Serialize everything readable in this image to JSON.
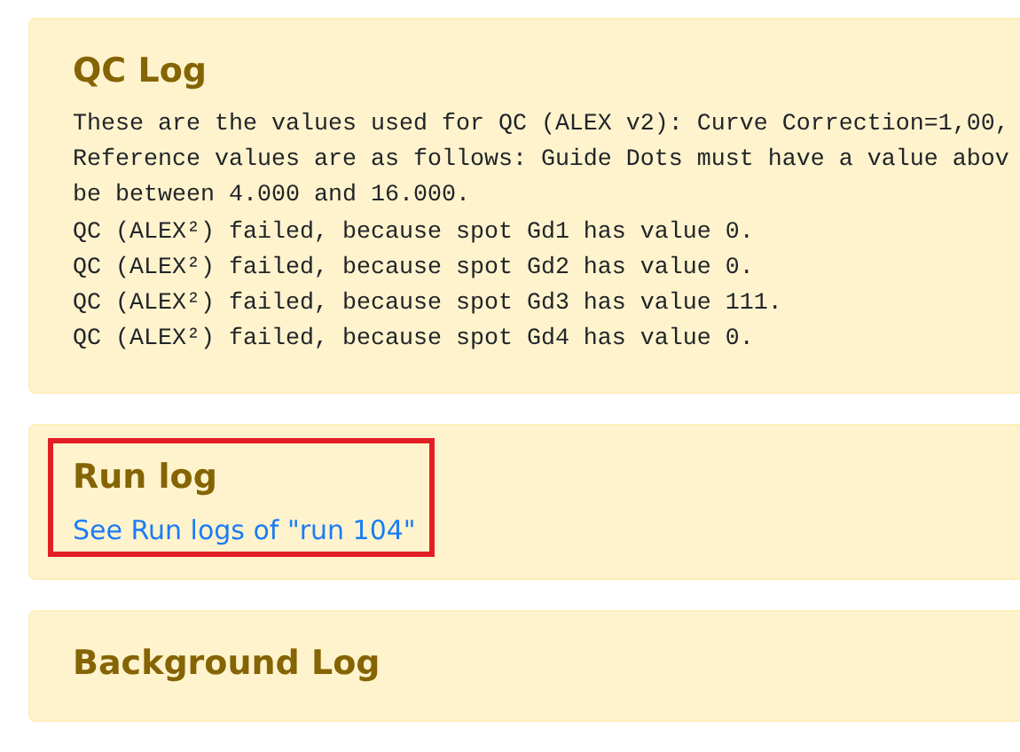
{
  "panels": [
    {
      "kind": "log",
      "title": "QC Log",
      "highlighted": false,
      "lines": [
        "These are the values used for QC (ALEX v2): Curve Correction=1,00,",
        "Reference values are as follows: Guide Dots must have a value abov",
        "be between 4.000 and 16.000.",
        "QC (ALEX²) failed, because spot Gd1 has value 0.",
        "QC (ALEX²) failed, because spot Gd2 has value 0.",
        "QC (ALEX²) failed, because spot Gd3 has value 111.",
        "QC (ALEX²) failed, because spot Gd4 has value 0."
      ]
    },
    {
      "kind": "link",
      "title": "Run log",
      "highlighted": true,
      "link": "See Run logs of \"run 104\""
    },
    {
      "kind": "empty",
      "title": "Background Log",
      "highlighted": false
    }
  ]
}
